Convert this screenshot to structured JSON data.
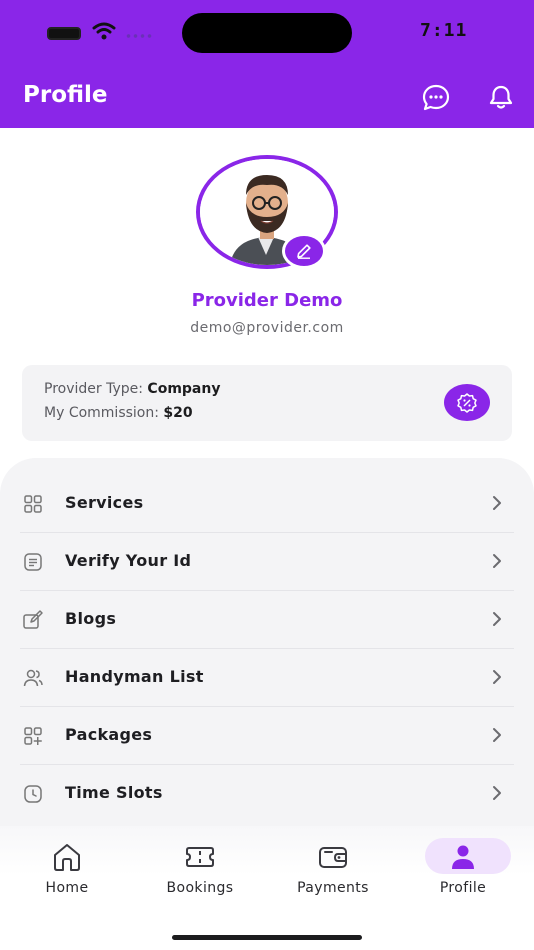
{
  "status_bar": {
    "time": "7:11"
  },
  "app_bar": {
    "title": "Profile",
    "icons": [
      "chat-icon",
      "bell-icon"
    ]
  },
  "profile": {
    "name": "Provider Demo",
    "email": "demo@provider.com"
  },
  "info_card": {
    "provider_type_label": "Provider Type: ",
    "provider_type_value": "Company",
    "commission_label": "My Commission: ",
    "commission_value": "$20"
  },
  "menu": {
    "items": [
      {
        "label": "Services",
        "icon": "grid-icon"
      },
      {
        "label": "Verify Your Id",
        "icon": "document-icon"
      },
      {
        "label": "Blogs",
        "icon": "blog-edit-icon"
      },
      {
        "label": "Handyman List",
        "icon": "users-icon"
      },
      {
        "label": "Packages",
        "icon": "packages-icon"
      },
      {
        "label": "Time Slots",
        "icon": "clock-icon"
      }
    ]
  },
  "bottom_nav": {
    "items": [
      {
        "label": "Home",
        "icon": "home-icon"
      },
      {
        "label": "Bookings",
        "icon": "ticket-icon"
      },
      {
        "label": "Payments",
        "icon": "wallet-icon"
      },
      {
        "label": "Profile",
        "icon": "person-icon",
        "active": true
      }
    ]
  },
  "colors": {
    "primary": "#8a26e8",
    "active_pill": "#f0e2fd",
    "panel": "#f4f4f6"
  }
}
